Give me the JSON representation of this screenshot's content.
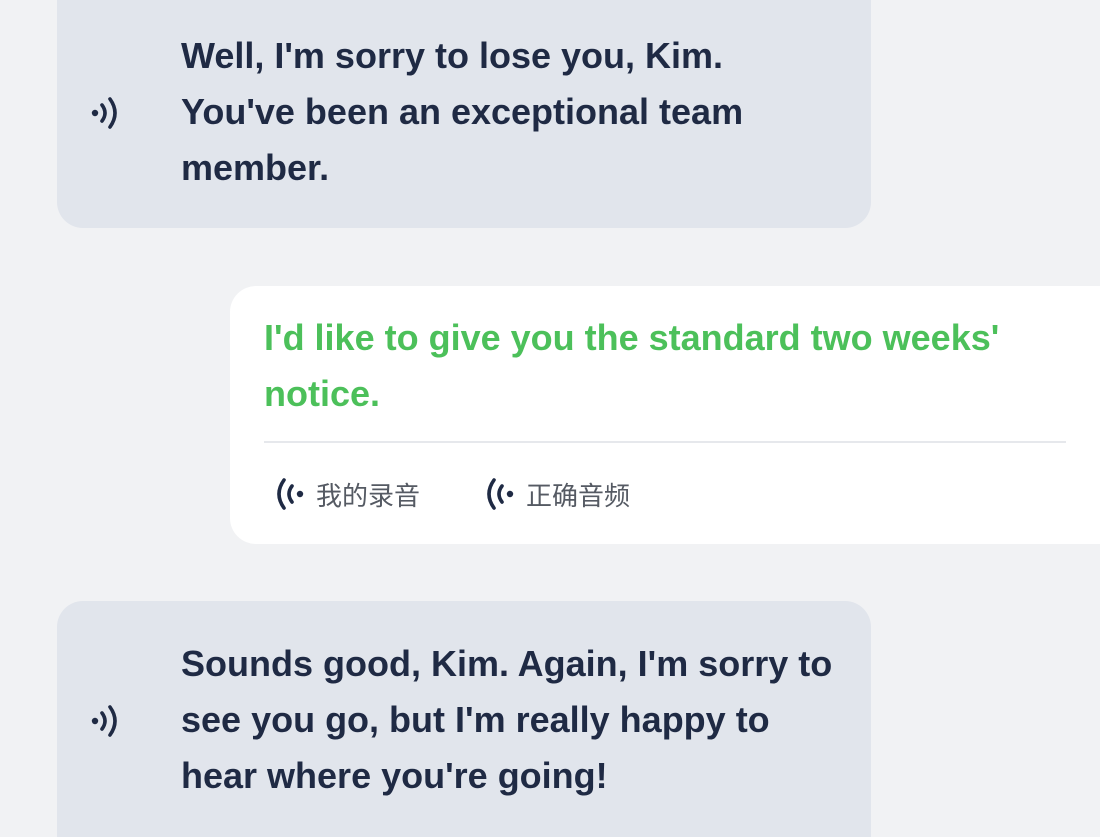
{
  "messages": [
    {
      "role": "partner",
      "text": "Well, I'm sorry to lose you, Kim. You've been an exceptional team member.",
      "icon": "speaker-icon"
    },
    {
      "role": "user",
      "text": "I'd like to give you the standard two weeks' notice.",
      "text_color": "#4cc05a",
      "actions": [
        {
          "label": "我的录音",
          "icon": "recording-wave-icon"
        },
        {
          "label": "正确音频",
          "icon": "correct-audio-wave-icon"
        }
      ]
    },
    {
      "role": "partner",
      "text": "Sounds good, Kim. Again, I'm sorry to see you go, but I'm really happy to hear where you're going!",
      "icon": "speaker-icon"
    }
  ],
  "colors": {
    "background": "#f1f2f4",
    "partner_bubble": "#e1e5ec",
    "user_bubble": "#ffffff",
    "text_dark": "#1f2a44",
    "accent_green": "#4cc05a"
  }
}
